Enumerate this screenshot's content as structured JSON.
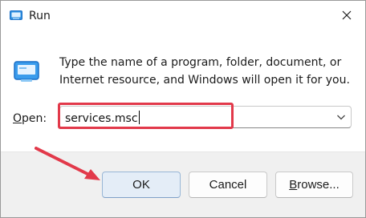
{
  "window": {
    "title": "Run"
  },
  "icons": {
    "app_icon": "run-app-icon",
    "close": "close-icon",
    "dropdown": "chevron-down-icon"
  },
  "description": "Type the name of a program, folder, document, or Internet resource, and Windows will open it for you.",
  "open_field": {
    "label_accel": "O",
    "label_rest": "pen:",
    "value": "services.msc"
  },
  "buttons": {
    "ok": "OK",
    "cancel": "Cancel",
    "browse_accel": "B",
    "browse_rest": "rowse..."
  },
  "colors": {
    "highlight": "#e2394a",
    "accent": "#1a6fc7"
  }
}
